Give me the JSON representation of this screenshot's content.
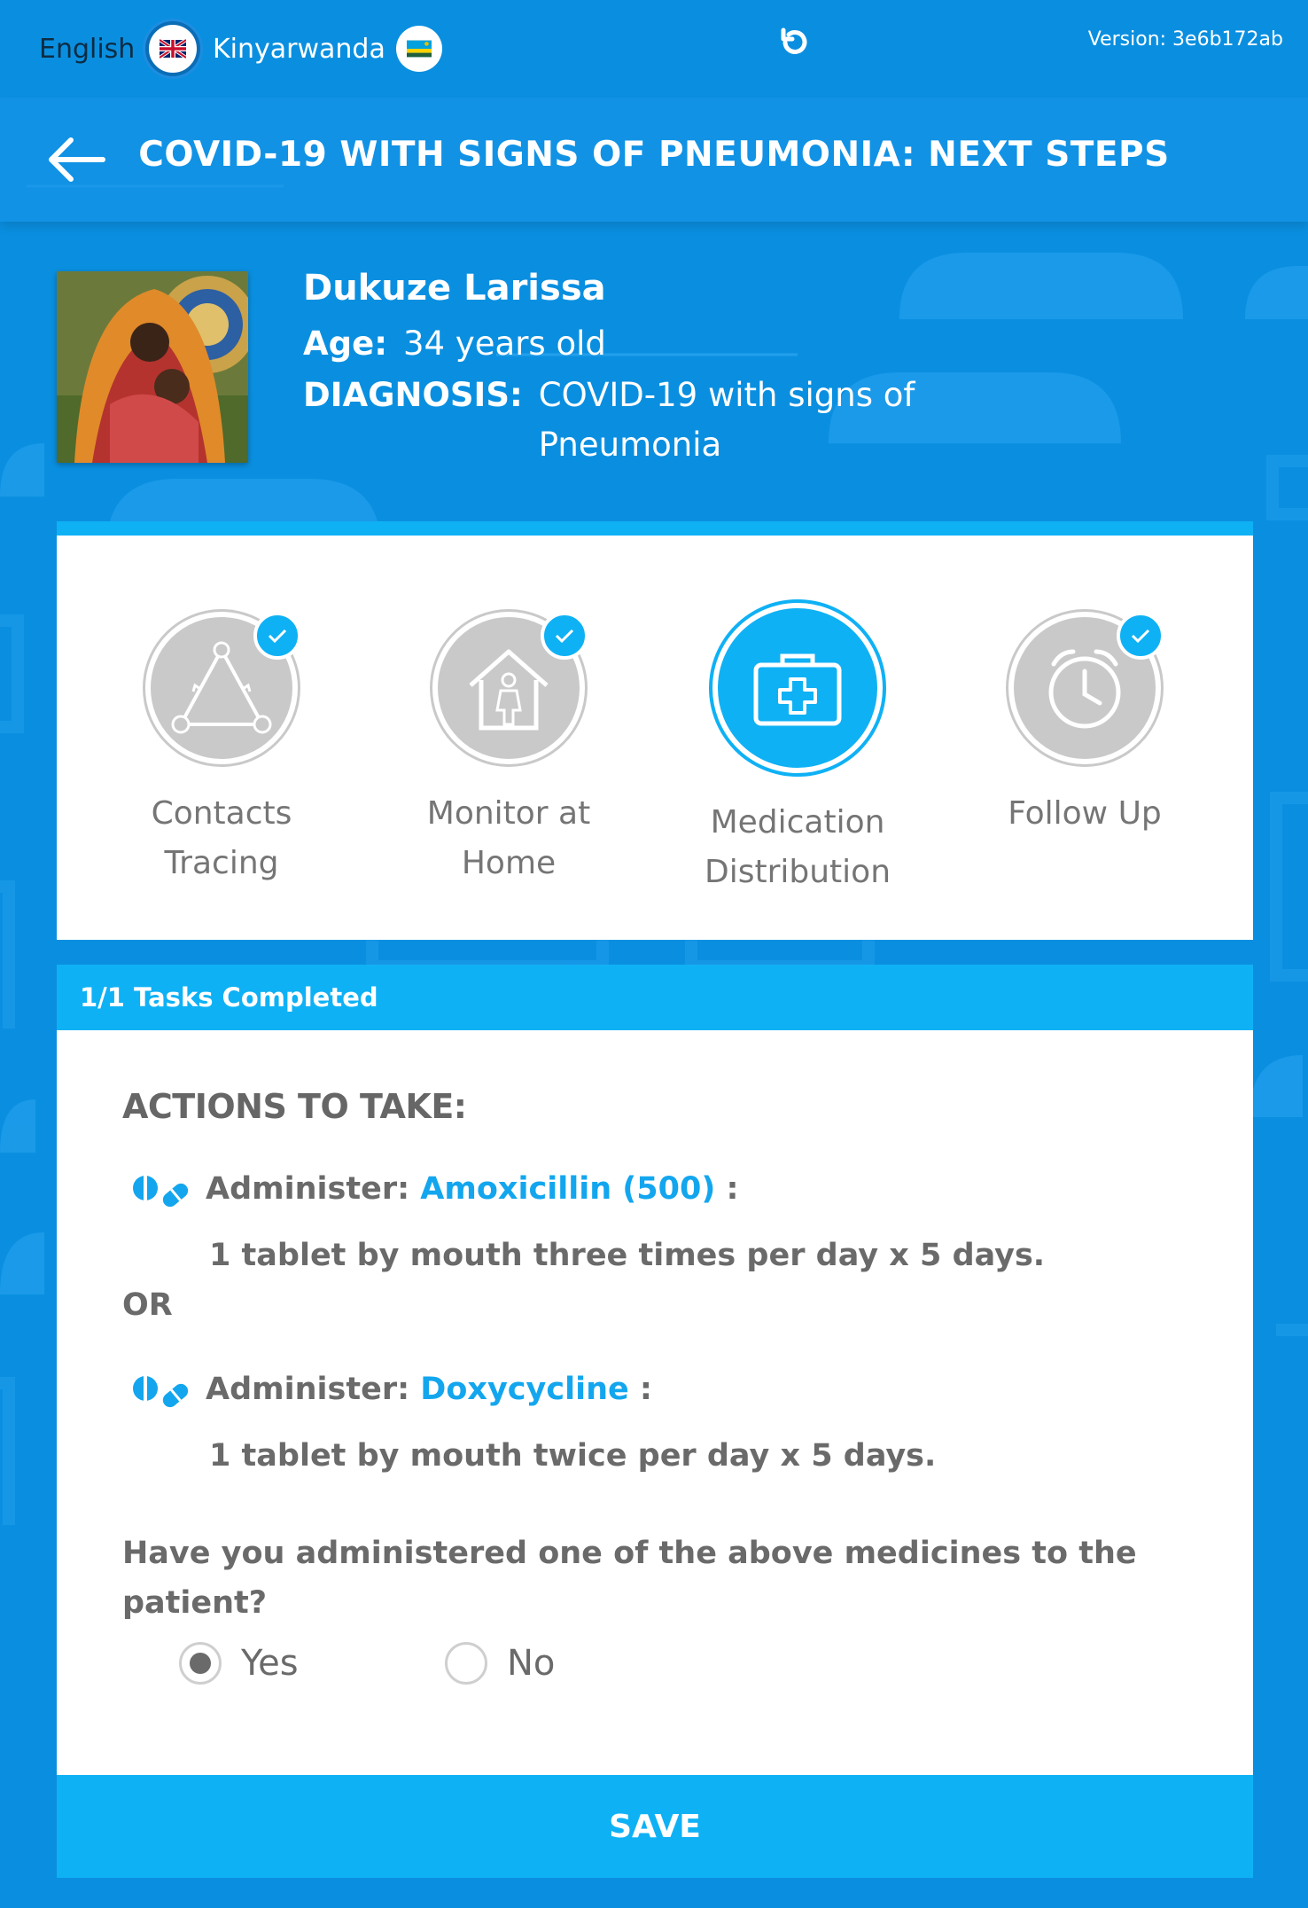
{
  "topbar": {
    "lang_en": "English",
    "lang_rw": "Kinyarwanda",
    "version": "Version: 3e6b172ab"
  },
  "header": {
    "title": "COVID-19 WITH SIGNS OF PNEUMONIA: NEXT STEPS"
  },
  "patient": {
    "name": "Dukuze Larissa",
    "age_label": "Age:",
    "age_value": "34 years old",
    "diagnosis_label": "DIAGNOSIS:",
    "diagnosis_value": "COVID-19 with signs of Pneumonia"
  },
  "steps": [
    {
      "label": "Contacts Tracing",
      "icon": "triangle-network-icon",
      "completed": true,
      "active": false
    },
    {
      "label": "Monitor at Home",
      "icon": "house-person-icon",
      "completed": true,
      "active": false
    },
    {
      "label": "Medication Distribution",
      "icon": "medical-kit-icon",
      "completed": false,
      "active": true
    },
    {
      "label": "Follow Up",
      "icon": "alarm-clock-icon",
      "completed": true,
      "active": false
    }
  ],
  "tasks": {
    "status": "1/1 Tasks Completed"
  },
  "actions": {
    "title": "ACTIONS TO TAKE:",
    "med1": {
      "prefix": "Administer:",
      "drug": "Amoxicillin (500)",
      "suffix": " :",
      "dose": "1 tablet by mouth three times per day x 5 days."
    },
    "or": "OR",
    "med2": {
      "prefix": "Administer:",
      "drug": "Doxycycline",
      "suffix": " :",
      "dose": "1 tablet by mouth twice per day x 5 days."
    },
    "question": "Have you administered one of the above medicines to the patient?",
    "options": {
      "yes": "Yes",
      "no": "No",
      "selected": "Yes"
    }
  },
  "save_label": "SAVE",
  "colors": {
    "background": "#0a8fe0",
    "accent": "#0fb1f5",
    "drug_text": "#13a6ee",
    "step_inactive": "#c9c9c9"
  }
}
